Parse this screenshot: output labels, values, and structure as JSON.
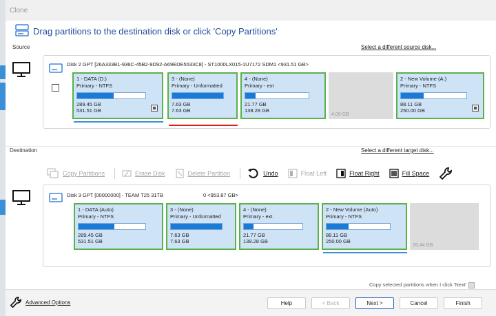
{
  "window": {
    "title": "Clone"
  },
  "header": {
    "text": "Drag partitions to the destination disk or click 'Copy Partitions'"
  },
  "source": {
    "label": "Source",
    "select_link": "Select a different source disk...",
    "disk_title": "Disk 2 GPT [26A333B1-936C-45B2-9D92-A69EDE5533C8] - ST1000LX015-1U7172 SDM1    <931.51 GB>",
    "partitions": [
      {
        "name": "1 - DATA (D:)",
        "type": "Primary - NTFS",
        "used": "289.45 GB",
        "total": "531.51 GB",
        "fill": 0.54
      },
      {
        "name": "3 -  (None)",
        "type": "Primary - Unformatted",
        "used": "7.63 GB",
        "total": "7.63 GB",
        "fill": 1.0
      },
      {
        "name": "4 -  (None)",
        "type": "Primary - ext",
        "used": "21.77 GB",
        "total": "138.28 GB",
        "fill": 0.16
      },
      {
        "name": "2 - New Volume (A:)",
        "type": "Primary - NTFS",
        "used": "88.11 GB",
        "total": "250.00 GB",
        "fill": 0.35
      }
    ],
    "unallocated": "4.09 GB"
  },
  "destination": {
    "label": "Destination",
    "select_link": "Select a different target disk...",
    "disk_title": "Disk 3 GPT [00000000] - TEAM T25 31TB",
    "disk_size": "0  <953.87 GB>",
    "partitions": [
      {
        "name": "1 - DATA (Auto)",
        "type": "Primary - NTFS",
        "used": "289.45 GB",
        "total": "531.51 GB",
        "fill": 0.54
      },
      {
        "name": "3 -  (None)",
        "type": "Primary - Unformatted",
        "used": "7.63 GB",
        "total": "7.63 GB",
        "fill": 1.0
      },
      {
        "name": "4 -  (None)",
        "type": "Primary - ext",
        "used": "21.77 GB",
        "total": "138.28 GB",
        "fill": 0.16
      },
      {
        "name": "2 - New Volume (Auto)",
        "type": "Primary - NTFS",
        "used": "88.11 GB",
        "total": "250.00 GB",
        "fill": 0.35
      }
    ],
    "unallocated": "26.44 GB"
  },
  "toolbar": {
    "copy_partitions": "Copy Partitions",
    "erase_disk": "Erase Disk",
    "delete_partition": "Delete Partition",
    "undo": "Undo",
    "float_left": "Float Left",
    "float_right": "Float Right",
    "fill_space": "Fill Space"
  },
  "footer": {
    "advanced_options": "Advanced Options",
    "copy_note": "Copy selected partitions when I click 'Next'",
    "help": "Help",
    "back": "< Back",
    "next": "Next >",
    "cancel": "Cancel",
    "finish": "Finish"
  }
}
